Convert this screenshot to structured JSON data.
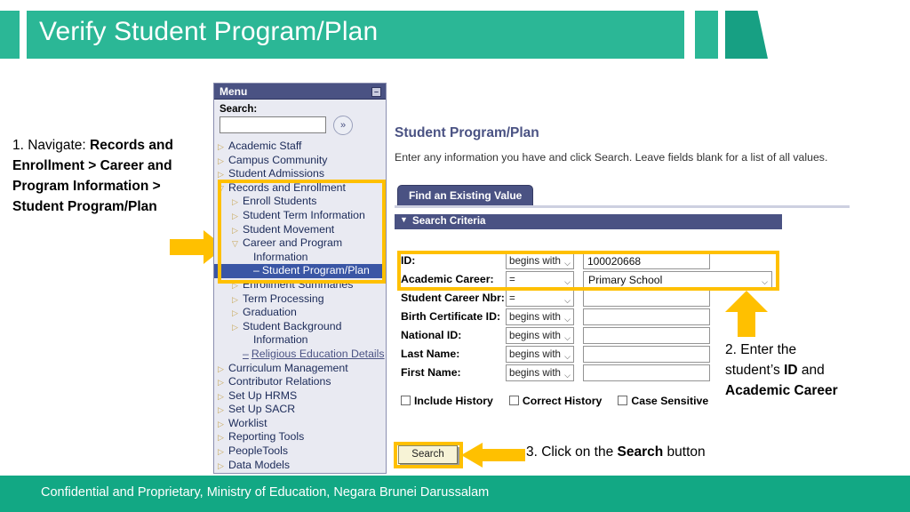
{
  "slide": {
    "title": "Verify Student Program/Plan",
    "footer": "Confidential and Proprietary, Ministry of Education, Negara Brunei Darussalam",
    "accent_teal": "#2bb796",
    "accent_teal_dark": "#17a083",
    "footer_green": "#12a884",
    "highlight_yellow": "#ffc000"
  },
  "callouts": {
    "step1_prefix": "1. Navigate: ",
    "step1_path": "Records and Enrollment > Career and Program Information > Student Program/Plan",
    "step2_line1": "2. Enter the",
    "step2_line2_prefix": "student’s ",
    "step2_line2_bold": "ID",
    "step2_line2_suffix": " and",
    "step2_line3": "Academic Career",
    "step3_prefix": "3. Click on the ",
    "step3_bold": "Search",
    "step3_suffix": " button"
  },
  "menu": {
    "header": "Menu",
    "collapse_icon": "minus-icon",
    "collapse_glyph": "–",
    "search_label": "Search:",
    "search_value": "",
    "search_placeholder": "",
    "go_icon": "double-chevron-right-icon",
    "go_glyph": "»",
    "items": [
      {
        "label": "Academic Staff",
        "level": 1,
        "state": "collapsed"
      },
      {
        "label": "Campus Community",
        "level": 1,
        "state": "collapsed"
      },
      {
        "label": "Student Admissions",
        "level": 1,
        "state": "collapsed"
      },
      {
        "label": "Records and Enrollment",
        "level": 1,
        "state": "expanded"
      },
      {
        "label": "Enroll Students",
        "level": 2,
        "state": "collapsed"
      },
      {
        "label": "Student Term Information",
        "level": 2,
        "state": "collapsed"
      },
      {
        "label": "Student Movement",
        "level": 2,
        "state": "collapsed"
      },
      {
        "label": "Career and Program",
        "level": 2,
        "state": "expanded"
      },
      {
        "label": "Information",
        "level": 2,
        "state": "wrap"
      },
      {
        "label": "Student Program/Plan",
        "level": 3,
        "state": "selected"
      },
      {
        "label": "Enrollment Summaries",
        "level": 2,
        "state": "collapsed"
      },
      {
        "label": "Term Processing",
        "level": 2,
        "state": "collapsed"
      },
      {
        "label": "Graduation",
        "level": 2,
        "state": "collapsed"
      },
      {
        "label": "Student Background",
        "level": 2,
        "state": "collapsed"
      },
      {
        "label": "Information",
        "level": 2,
        "state": "wrap"
      },
      {
        "label": "Religious Education Details",
        "level": 2,
        "state": "link"
      },
      {
        "label": "Curriculum Management",
        "level": 1,
        "state": "collapsed"
      },
      {
        "label": "Contributor Relations",
        "level": 1,
        "state": "collapsed"
      },
      {
        "label": "Set Up HRMS",
        "level": 1,
        "state": "collapsed"
      },
      {
        "label": "Set Up SACR",
        "level": 1,
        "state": "collapsed"
      },
      {
        "label": "Worklist",
        "level": 1,
        "state": "collapsed"
      },
      {
        "label": "Reporting Tools",
        "level": 1,
        "state": "collapsed"
      },
      {
        "label": "PeopleTools",
        "level": 1,
        "state": "collapsed"
      },
      {
        "label": "Data Models",
        "level": 1,
        "state": "collapsed"
      }
    ]
  },
  "page": {
    "title": "Student Program/Plan",
    "instruction": "Enter any information you have and click Search. Leave fields blank for a list of all values.",
    "tab_label": "Find an Existing Value",
    "criteria_label": "Search Criteria",
    "criteria_caret": "▼",
    "fields": [
      {
        "label": "ID:",
        "operator": "begins with",
        "value": "100020668",
        "kind": "text"
      },
      {
        "label": "Academic Career:",
        "operator": "=",
        "value": "Primary School",
        "kind": "dropdown"
      },
      {
        "label": "Student Career Nbr:",
        "operator": "=",
        "value": "",
        "kind": "text"
      },
      {
        "label": "Birth Certificate ID:",
        "operator": "begins with",
        "value": "",
        "kind": "text"
      },
      {
        "label": "National ID:",
        "operator": "begins with",
        "value": "",
        "kind": "text"
      },
      {
        "label": "Last Name:",
        "operator": "begins with",
        "value": "",
        "kind": "text"
      },
      {
        "label": "First Name:",
        "operator": "begins with",
        "value": "",
        "kind": "text"
      }
    ],
    "checkboxes": [
      {
        "label": "Include History",
        "checked": false
      },
      {
        "label": "Correct History",
        "checked": false
      },
      {
        "label": "Case Sensitive",
        "checked": false
      }
    ],
    "search_button": "Search"
  }
}
